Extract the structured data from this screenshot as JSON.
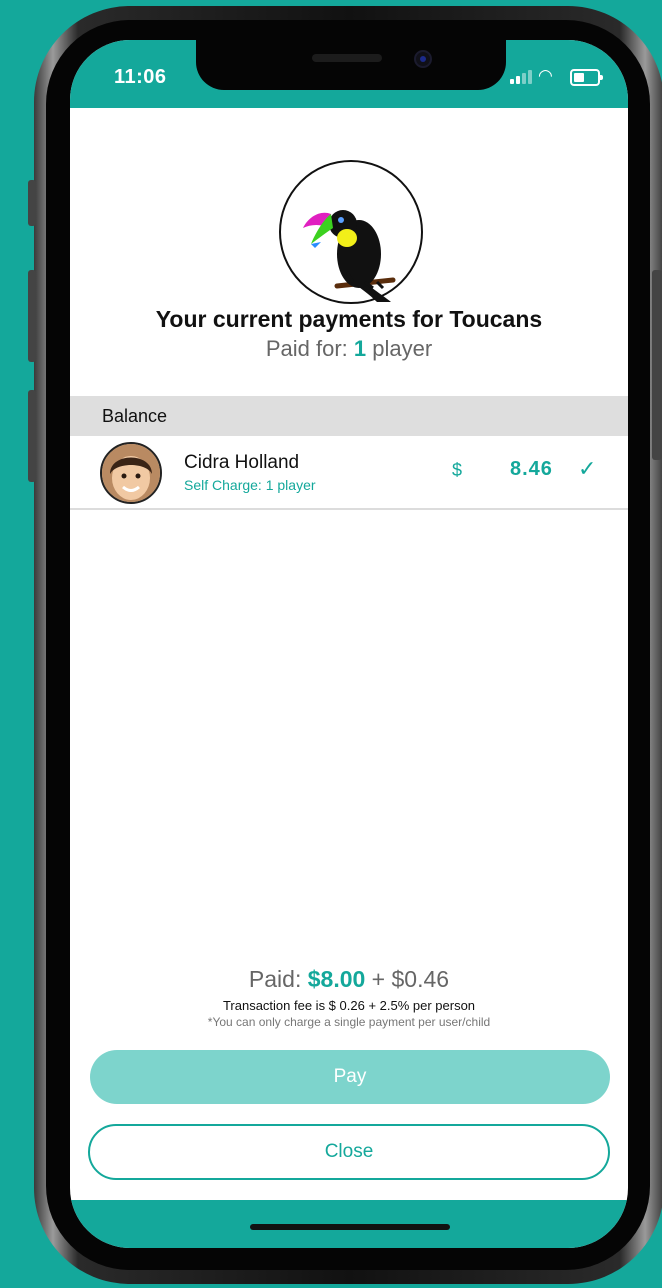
{
  "status_bar": {
    "time": "11:06"
  },
  "team": {
    "title": "Your current payments for Toucans",
    "paid_for_prefix": "Paid for: ",
    "paid_for_count": "1",
    "paid_for_suffix": " player"
  },
  "balance_section": {
    "header": "Balance",
    "members": [
      {
        "name": "Cidra Holland",
        "subtitle": "Self Charge: 1 player",
        "currency": "$",
        "amount": "8.46",
        "checked_icon": "✓"
      }
    ]
  },
  "summary": {
    "paid_label": "Paid: ",
    "paid_amount": "$8.00",
    "fee_addition": " + $0.46",
    "fee_text": "Transaction fee is $ 0.26 + 2.5% per person",
    "note_text": "*You can only charge a single payment per user/child"
  },
  "actions": {
    "pay_label": "Pay",
    "close_label": "Close"
  },
  "theme": {
    "accent": "#14a89b",
    "pay_disabled": "#7dd4cc",
    "section_header_bg": "#dedede"
  },
  "icons": {
    "team_logo": "toucan-logo",
    "wifi": "wifi-icon",
    "signal": "signal-icon",
    "battery": "battery-icon",
    "check": "check-icon"
  }
}
